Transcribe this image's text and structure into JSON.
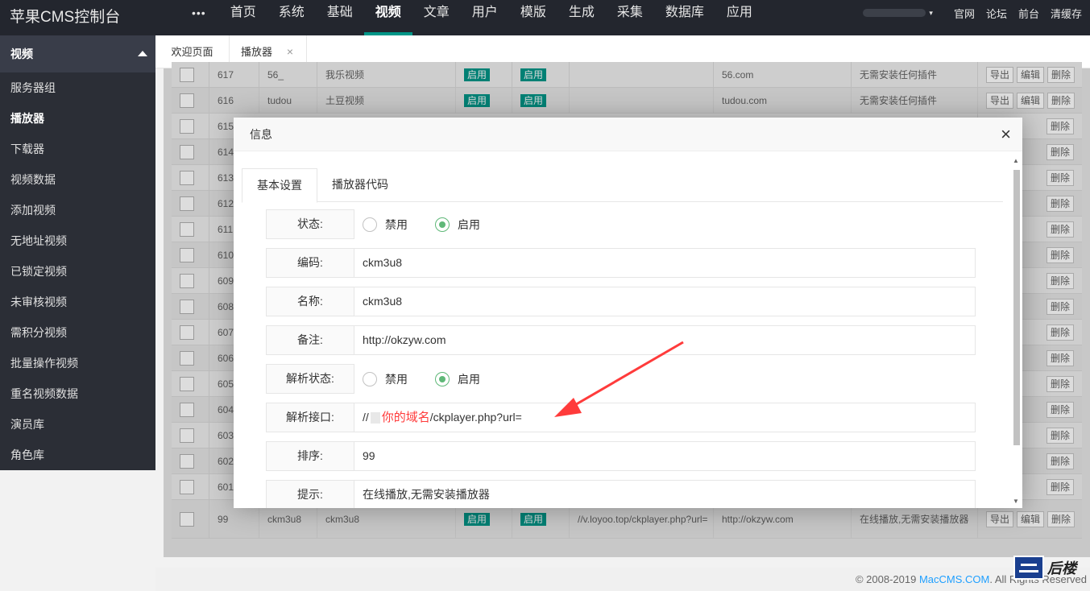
{
  "app": {
    "title": "苹果CMS控制台"
  },
  "topnav": {
    "more": "•••",
    "items": [
      "首页",
      "系统",
      "基础",
      "视频",
      "文章",
      "用户",
      "模版",
      "生成",
      "采集",
      "数据库",
      "应用"
    ],
    "active": "视频"
  },
  "topright": {
    "caret": "▾",
    "links": [
      "官网",
      "论坛",
      "前台",
      "清缓存"
    ]
  },
  "sidebar": {
    "header": "视频",
    "items": [
      "服务器组",
      "播放器",
      "下载器",
      "视频数据",
      "添加视频",
      "无地址视频",
      "已锁定视频",
      "未审核视频",
      "需积分视频",
      "批量操作视频",
      "重名视频数据",
      "演员库",
      "角色库"
    ],
    "active": "播放器"
  },
  "tabs": {
    "welcome": "欢迎页面",
    "player": "播放器",
    "close": "×"
  },
  "table": {
    "rows": [
      {
        "id": "617",
        "code": "56_",
        "name": "我乐视频",
        "s1": "启用",
        "s2": "启用",
        "url": "",
        "domain": "56.com",
        "tip": "无需安装任何插件"
      },
      {
        "id": "616",
        "code": "tudou",
        "name": "土豆视频",
        "s1": "启用",
        "s2": "启用",
        "url": "",
        "domain": "tudou.com",
        "tip": "无需安装任何插件"
      },
      {
        "id": "615"
      },
      {
        "id": "614"
      },
      {
        "id": "613"
      },
      {
        "id": "612"
      },
      {
        "id": "611"
      },
      {
        "id": "610"
      },
      {
        "id": "609"
      },
      {
        "id": "608"
      },
      {
        "id": "607"
      },
      {
        "id": "606"
      },
      {
        "id": "605"
      },
      {
        "id": "604"
      },
      {
        "id": "603"
      },
      {
        "id": "602"
      },
      {
        "id": "601"
      },
      {
        "id": "99",
        "code": "ckm3u8",
        "name": "ckm3u8",
        "s1": "启用",
        "s2": "启用",
        "url": "//v.loyoo.top/ckplayer.php?url=",
        "domain": "http://okzyw.com",
        "tip": "在线播放,无需安装播放器"
      }
    ],
    "actions": {
      "export": "导出",
      "edit": "编辑",
      "delete": "删除"
    }
  },
  "footer": {
    "copy": "© 2008-2019 ",
    "brand": "MacCMS.COM",
    "rights": ". All Rights Reserved"
  },
  "modal": {
    "title": "信息",
    "close": "×",
    "tabs": [
      "基本设置",
      "播放器代码"
    ],
    "fields": {
      "status_label": "状态:",
      "disable": "禁用",
      "enable": "启用",
      "code_label": "编码:",
      "code_value": "ckm3u8",
      "name_label": "名称:",
      "name_value": "ckm3u8",
      "note_label": "备注:",
      "note_value": "http://okzyw.com",
      "parse_status_label": "解析状态:",
      "parse_api_label": "解析接口:",
      "parse_api_prefix": "//",
      "parse_api_annotation": "你的域名",
      "parse_api_suffix": "/ckplayer.php?url=",
      "sort_label": "排序:",
      "sort_value": "99",
      "tip_label": "提示:",
      "tip_value": "在线播放,无需安装播放器"
    }
  },
  "watermark": {
    "text": "后楼"
  },
  "colors": {
    "accent": "#009688",
    "radio": "#5fb878",
    "annotation": "#ff3b3b",
    "link": "#1e9fff"
  }
}
